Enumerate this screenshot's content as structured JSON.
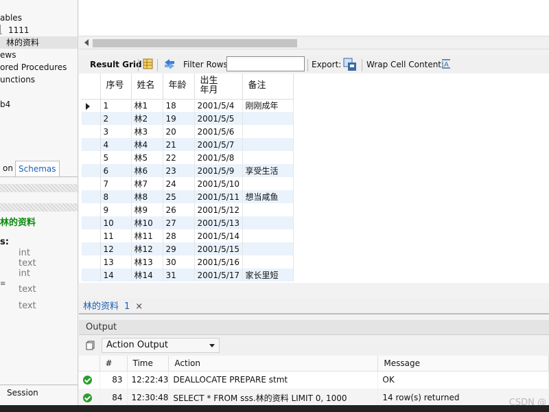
{
  "navigator": {
    "tree": [
      "ables",
      "1111",
      "林的资料",
      "ews",
      "ored Procedures",
      "unctions",
      "b4"
    ],
    "tabs": [
      "on",
      "Schemas"
    ],
    "info_title": "林的资料",
    "info_label": "s:",
    "column_types": [
      "int",
      "text",
      "int",
      "text",
      "text"
    ],
    "session_tab": "Session"
  },
  "toolbar": {
    "result_grid": "Result Grid",
    "filter_rows": "Filter Rows:",
    "filter_value": "",
    "export": "Export:",
    "wrap": "Wrap Cell Content:"
  },
  "grid": {
    "headers": [
      "序号",
      "姓名",
      "年龄",
      "出生\n年月",
      "备注"
    ],
    "rows": [
      [
        "1",
        "林1",
        "18",
        "2001/5/4",
        "刚刚成年"
      ],
      [
        "2",
        "林2",
        "19",
        "2001/5/5",
        ""
      ],
      [
        "3",
        "林3",
        "20",
        "2001/5/6",
        ""
      ],
      [
        "4",
        "林4",
        "21",
        "2001/5/7",
        ""
      ],
      [
        "5",
        "林5",
        "22",
        "2001/5/8",
        ""
      ],
      [
        "6",
        "林6",
        "23",
        "2001/5/9",
        "享受生活"
      ],
      [
        "7",
        "林7",
        "24",
        "2001/5/10",
        ""
      ],
      [
        "8",
        "林8",
        "25",
        "2001/5/11",
        "想当咸鱼"
      ],
      [
        "9",
        "林9",
        "26",
        "2001/5/12",
        ""
      ],
      [
        "10",
        "林10",
        "27",
        "2001/5/13",
        ""
      ],
      [
        "11",
        "林11",
        "28",
        "2001/5/14",
        ""
      ],
      [
        "12",
        "林12",
        "29",
        "2001/5/15",
        ""
      ],
      [
        "13",
        "林13",
        "30",
        "2001/5/16",
        ""
      ],
      [
        "14",
        "林14",
        "31",
        "2001/5/17",
        "家长里短"
      ]
    ]
  },
  "result_tab": {
    "label": "林的资料",
    "num": "1",
    "close": "×"
  },
  "output": {
    "title": "Output",
    "selector": "Action Output",
    "headers": [
      "#",
      "Time",
      "Action",
      "Message"
    ],
    "rows": [
      {
        "n": "83",
        "time": "12:22:43",
        "action": "DEALLOCATE PREPARE stmt",
        "message": "OK"
      },
      {
        "n": "84",
        "time": "12:30:48",
        "action": "SELECT * FROM sss.林的资料 LIMIT 0, 1000",
        "message": "14 row(s) returned"
      }
    ]
  },
  "watermark": "CSDN @"
}
